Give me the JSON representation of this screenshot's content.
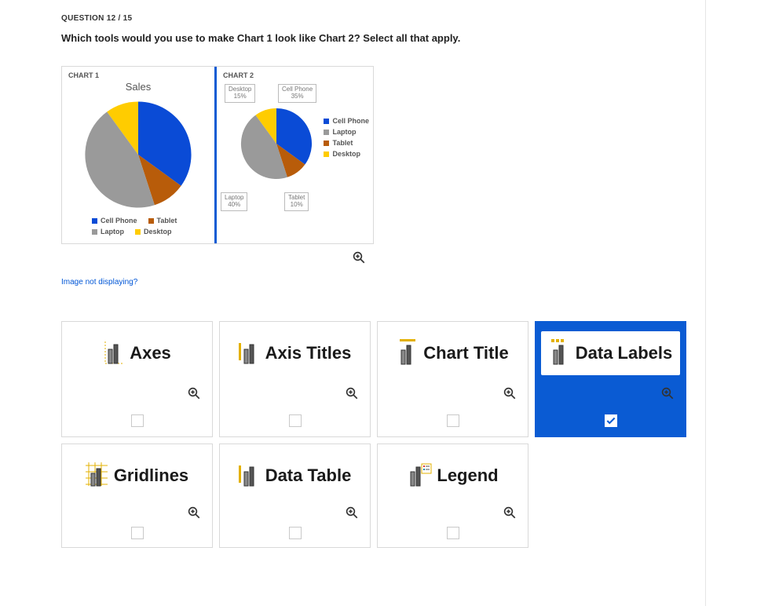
{
  "question_number": "QUESTION 12 / 15",
  "question_text": "Which tools would you use to make Chart 1 look like Chart 2? Select all that apply.",
  "chart1_label": "CHART 1",
  "chart2_label": "CHART 2",
  "chart1_title": "Sales",
  "legend_items": [
    "Cell Phone",
    "Tablet",
    "Laptop",
    "Desktop"
  ],
  "legend2_items": [
    "Cell Phone",
    "Laptop",
    "Tablet",
    "Desktop"
  ],
  "callouts": {
    "desktop": "Desktop\n15%",
    "cellphone": "Cell Phone\n35%",
    "laptop": "Laptop\n40%",
    "tablet": "Tablet\n10%"
  },
  "not_displaying": "Image not displaying?",
  "options": [
    {
      "id": "axes",
      "label": "Axes",
      "selected": false
    },
    {
      "id": "axis-titles",
      "label": "Axis Titles",
      "selected": false
    },
    {
      "id": "chart-title",
      "label": "Chart Title",
      "selected": false
    },
    {
      "id": "data-labels",
      "label": "Data Labels",
      "selected": true
    },
    {
      "id": "gridlines",
      "label": "Gridlines",
      "selected": false
    },
    {
      "id": "data-table",
      "label": "Data Table",
      "selected": false
    },
    {
      "id": "legend",
      "label": "Legend",
      "selected": false
    }
  ],
  "colors": {
    "cellphone": "#0a4bd6",
    "laptop": "#9a9a9a",
    "tablet": "#b85c0a",
    "desktop": "#ffcc00"
  },
  "chart_data": [
    {
      "type": "pie",
      "title": "Sales",
      "series": [
        {
          "name": "Cell Phone",
          "value": 35
        },
        {
          "name": "Laptop",
          "value": 40
        },
        {
          "name": "Tablet",
          "value": 10
        },
        {
          "name": "Desktop",
          "value": 15
        }
      ],
      "data_labels": false,
      "legend_position": "bottom"
    },
    {
      "type": "pie",
      "title": "",
      "series": [
        {
          "name": "Cell Phone",
          "value": 35
        },
        {
          "name": "Laptop",
          "value": 40
        },
        {
          "name": "Tablet",
          "value": 10
        },
        {
          "name": "Desktop",
          "value": 15
        }
      ],
      "data_labels": true,
      "legend_position": "right"
    }
  ]
}
